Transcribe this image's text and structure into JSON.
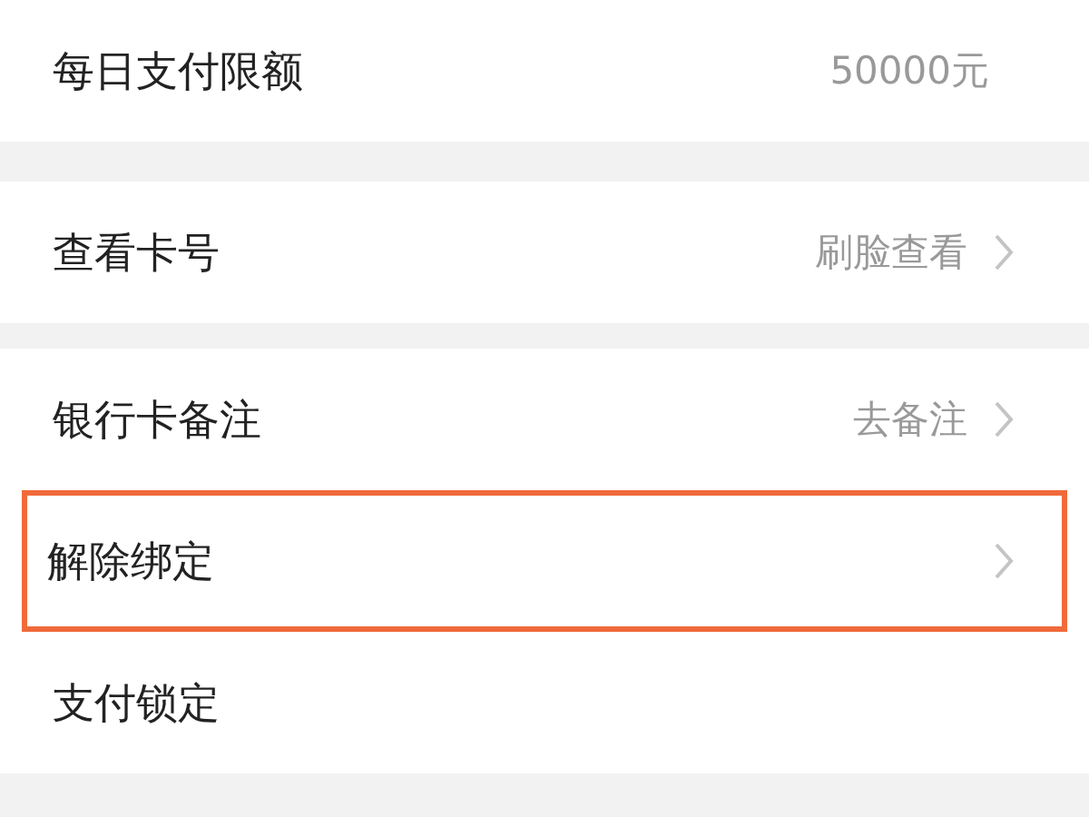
{
  "groups": [
    {
      "rows": [
        {
          "label": "每日支付限额",
          "value": "50000元",
          "chevron": false,
          "highlighted": false
        }
      ]
    },
    {
      "rows": [
        {
          "label": "查看卡号",
          "value": "刷脸查看",
          "chevron": true,
          "highlighted": false
        }
      ]
    },
    {
      "rows": [
        {
          "label": "银行卡备注",
          "value": "去备注",
          "chevron": true,
          "highlighted": false
        },
        {
          "label": "解除绑定",
          "chevron": true,
          "highlighted": true
        },
        {
          "label": "支付锁定",
          "chevron": false,
          "highlighted": false
        }
      ]
    }
  ]
}
